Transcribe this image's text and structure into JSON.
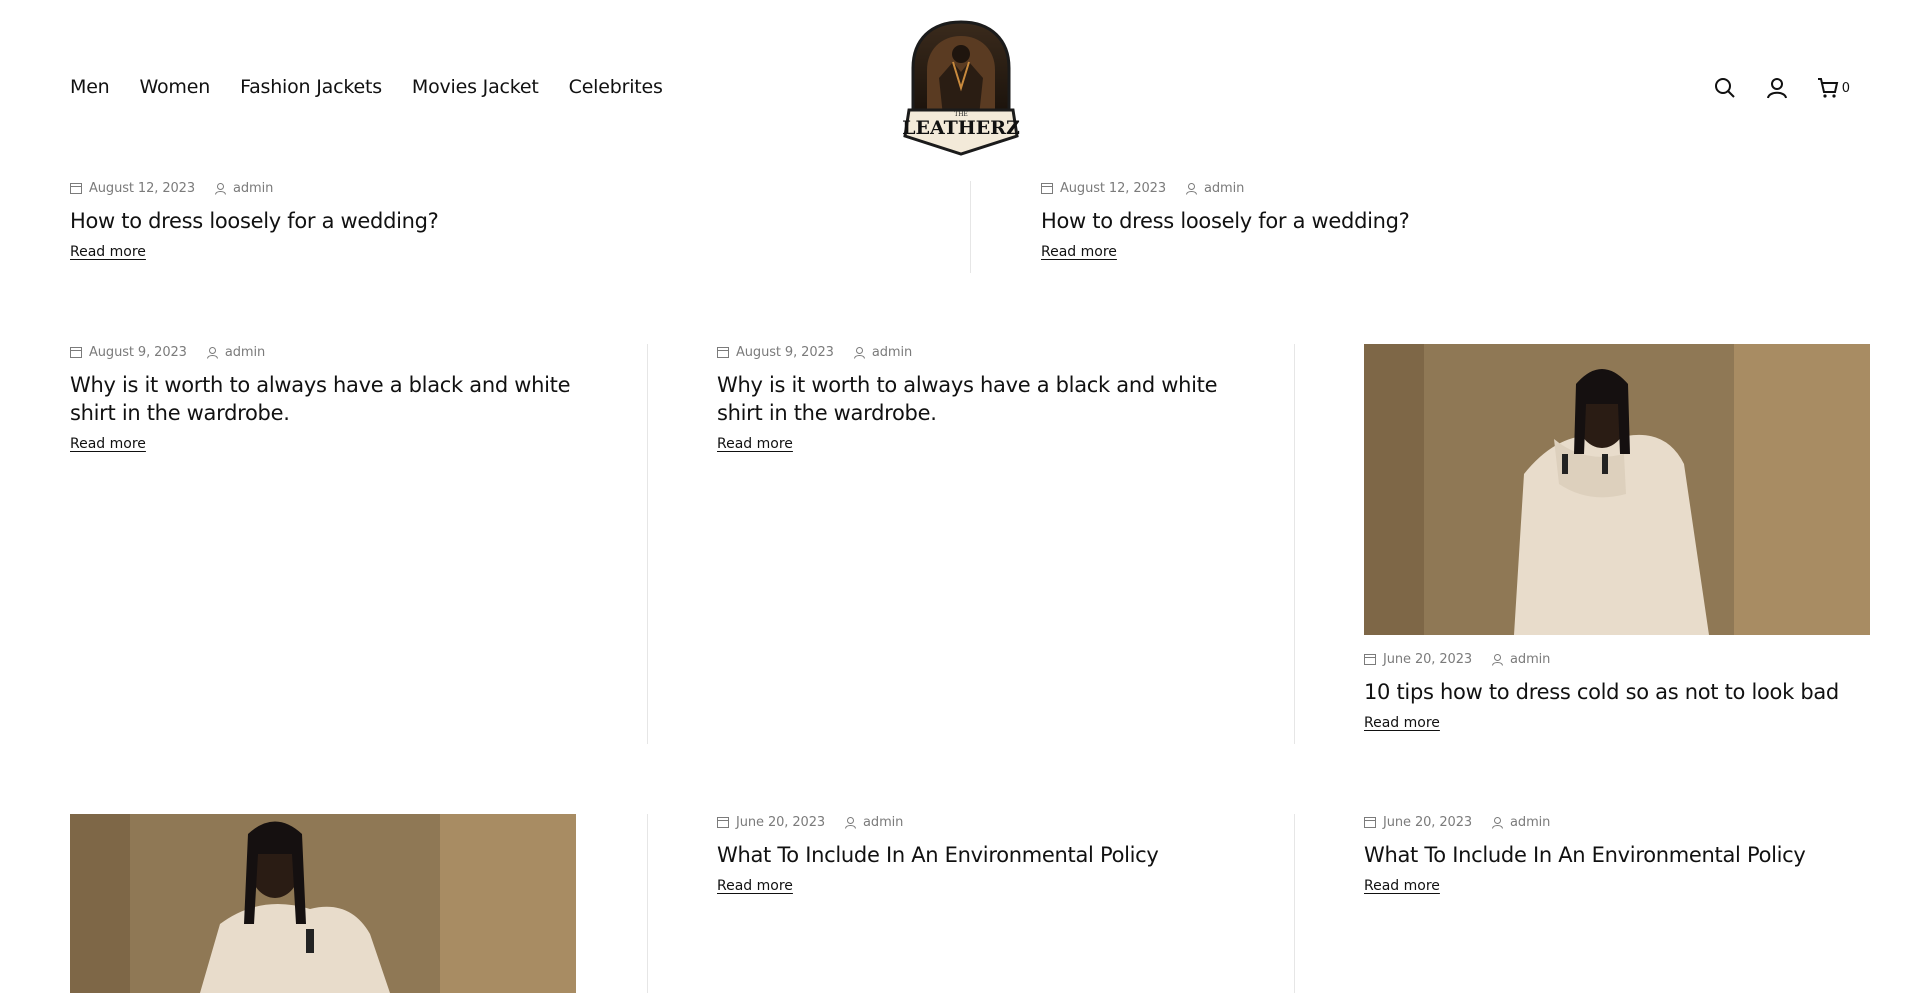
{
  "header": {
    "nav": [
      "Men",
      "Women",
      "Fashion Jackets",
      "Movies Jacket",
      "Celebrites"
    ],
    "logo_text": "LEATHERZ",
    "logo_small": "THE",
    "cart_count": "0",
    "icons": [
      "search-icon",
      "user-icon",
      "cart-icon"
    ]
  },
  "posts": {
    "p1": {
      "date": "August 12, 2023",
      "author": "admin",
      "title": "How to dress loosely for a wedding?",
      "read_more": "Read more"
    },
    "p2": {
      "date": "August 12, 2023",
      "author": "admin",
      "title": "How to dress loosely for a wedding?",
      "read_more": "Read more"
    },
    "p3": {
      "date": "August 9, 2023",
      "author": "admin",
      "title": "Why is it worth to always have a black and white shirt in the wardrobe.",
      "read_more": "Read more"
    },
    "p4": {
      "date": "August 9, 2023",
      "author": "admin",
      "title": "Why is it worth to always have a black and white shirt in the wardrobe.",
      "read_more": "Read more"
    },
    "p5": {
      "date": "June 20, 2023",
      "author": "admin",
      "title": "10 tips how to dress cold so as not to look bad",
      "read_more": "Read more"
    },
    "p6": {
      "date": "June 20, 2023",
      "author": "admin",
      "title": "What To Include In An Environmental Policy",
      "read_more": "Read more"
    },
    "p7": {
      "date": "June 20, 2023",
      "author": "admin",
      "title": "What To Include In An Environmental Policy",
      "read_more": "Read more"
    }
  },
  "colors": {
    "text": "#111111",
    "meta": "#7b7b7b",
    "divider": "#e6e6e6",
    "photo_bg": "#9c8460"
  }
}
